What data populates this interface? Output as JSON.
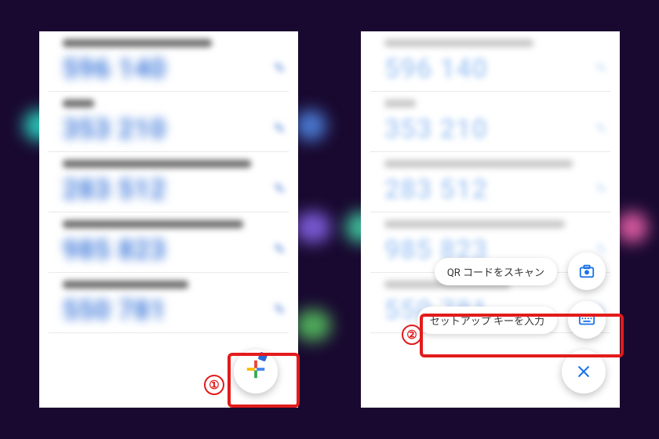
{
  "left": {
    "rows": [
      {
        "labelWidth": 190,
        "code": "596 140"
      },
      {
        "labelWidth": 40,
        "code": "353 210"
      },
      {
        "labelWidth": 240,
        "code": "283 512"
      },
      {
        "labelWidth": 230,
        "code": "985 823"
      },
      {
        "labelWidth": 160,
        "code": "550 781"
      }
    ]
  },
  "right": {
    "rows": [
      {
        "labelWidth": 190,
        "code": "596 140"
      },
      {
        "labelWidth": 40,
        "code": "353 210"
      },
      {
        "labelWidth": 240,
        "code": "283 512"
      },
      {
        "labelWidth": 230,
        "code": "985 823"
      },
      {
        "labelWidth": 160,
        "code": "550 781"
      }
    ],
    "menu": {
      "scan": "QR コードをスキャン",
      "key": "セットアップ キーを入力"
    }
  },
  "badges": {
    "one": "①",
    "two": "②"
  }
}
